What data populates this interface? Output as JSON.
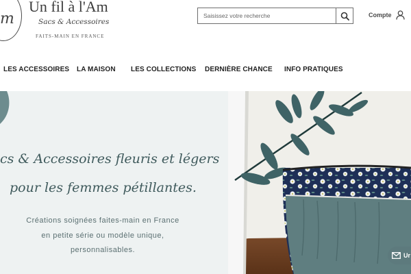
{
  "logo": {
    "title": "Un fil à l'Am",
    "subtitle": "Sacs & Accessoires",
    "tagline": "FAITS-MAIN EN FRANCE",
    "mark_letter": "m"
  },
  "search": {
    "placeholder": "Saisissez votre recherche",
    "value": "",
    "icon": "search-icon"
  },
  "account": {
    "label": "Compte",
    "icon": "user-icon"
  },
  "nav": {
    "items": [
      {
        "label": "LES ACCESSOIRES"
      },
      {
        "label": "LA MAISON"
      },
      {
        "label": "LES COLLECTIONS"
      },
      {
        "label": "DERNIÈRE CHANCE"
      },
      {
        "label": "INFO PRATIQUES"
      }
    ]
  },
  "hero": {
    "headline_line1": "cs & Accessoires fleuris et légers",
    "headline_line2": "pour les femmes pétillantes.",
    "desc_line1": "Créations soignées faites-main en France",
    "desc_line2": "en petite série ou modèle unique,",
    "desc_line3": "personnalisables.",
    "photo": "pouch-with-leaves-photo"
  },
  "chat": {
    "label": "Ur",
    "icon": "mail-icon"
  },
  "colors": {
    "accent": "#5d7a7d",
    "hero_bg": "#eef2f2",
    "script_text": "#3f5a5c",
    "nav_text": "#222222"
  }
}
